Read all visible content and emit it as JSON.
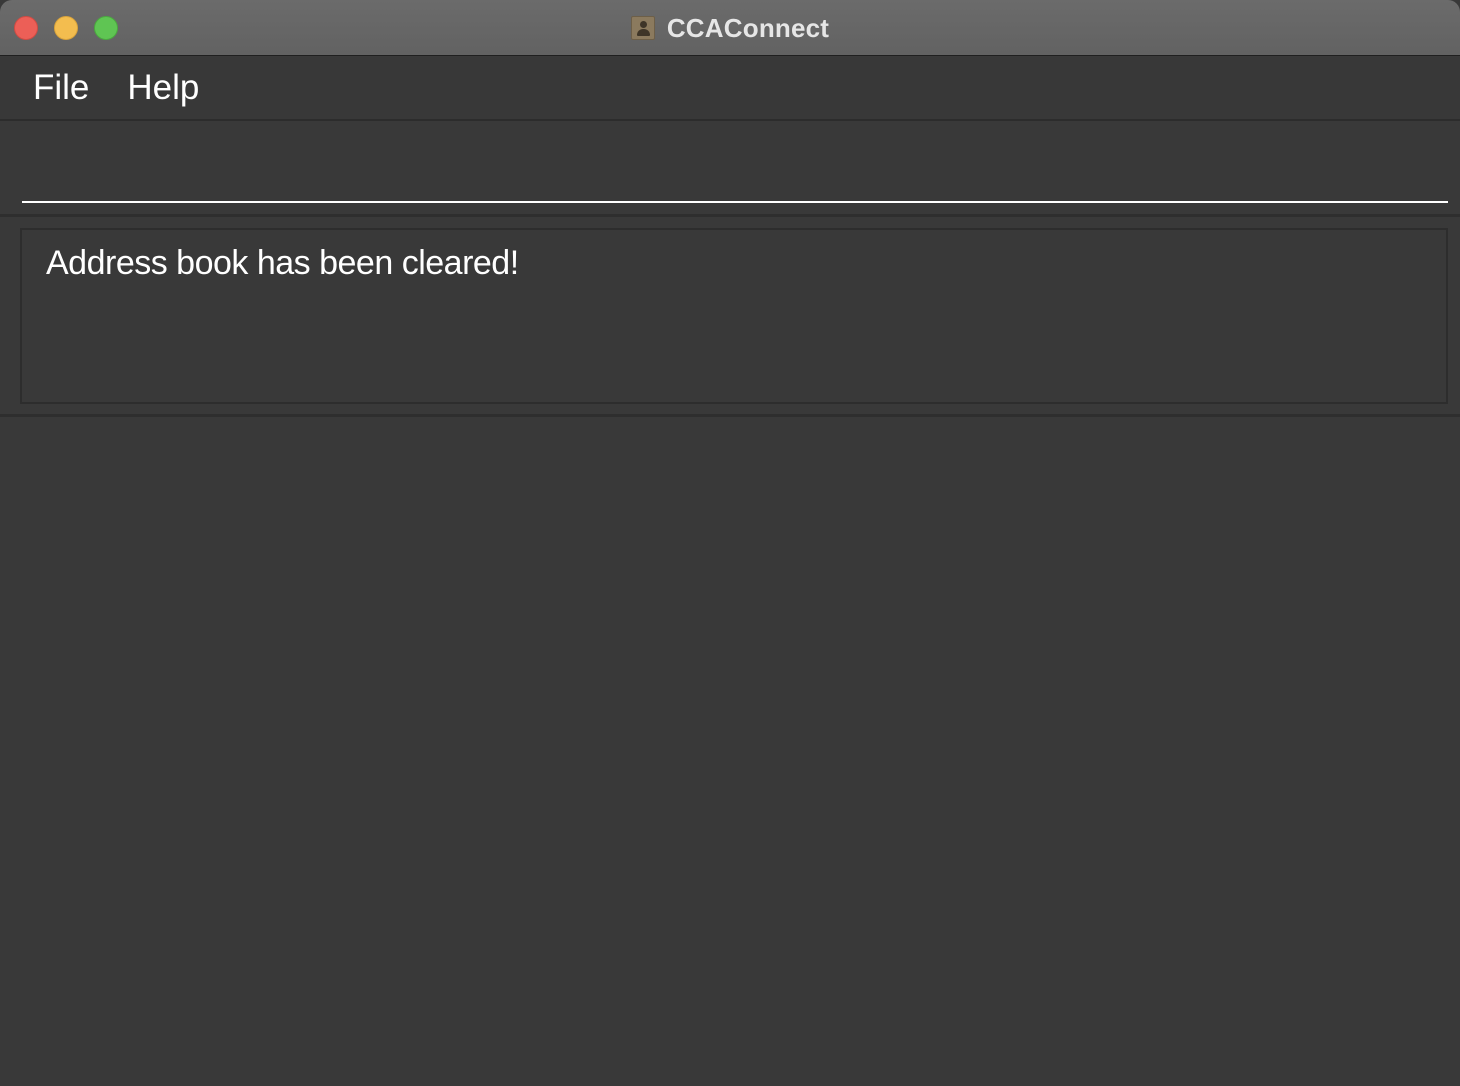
{
  "window": {
    "title": "CCAConnect",
    "app_icon": "contacts-book-icon"
  },
  "menu": {
    "file_label": "File",
    "help_label": "Help"
  },
  "command": {
    "value": "",
    "placeholder": ""
  },
  "result": {
    "message": "Address book has been cleared!"
  },
  "colors": {
    "background": "#393939",
    "titlebar": "#666666",
    "text": "#ffffff",
    "close": "#ec5f57",
    "minimize": "#f3bd4f",
    "maximize": "#5fc553"
  }
}
